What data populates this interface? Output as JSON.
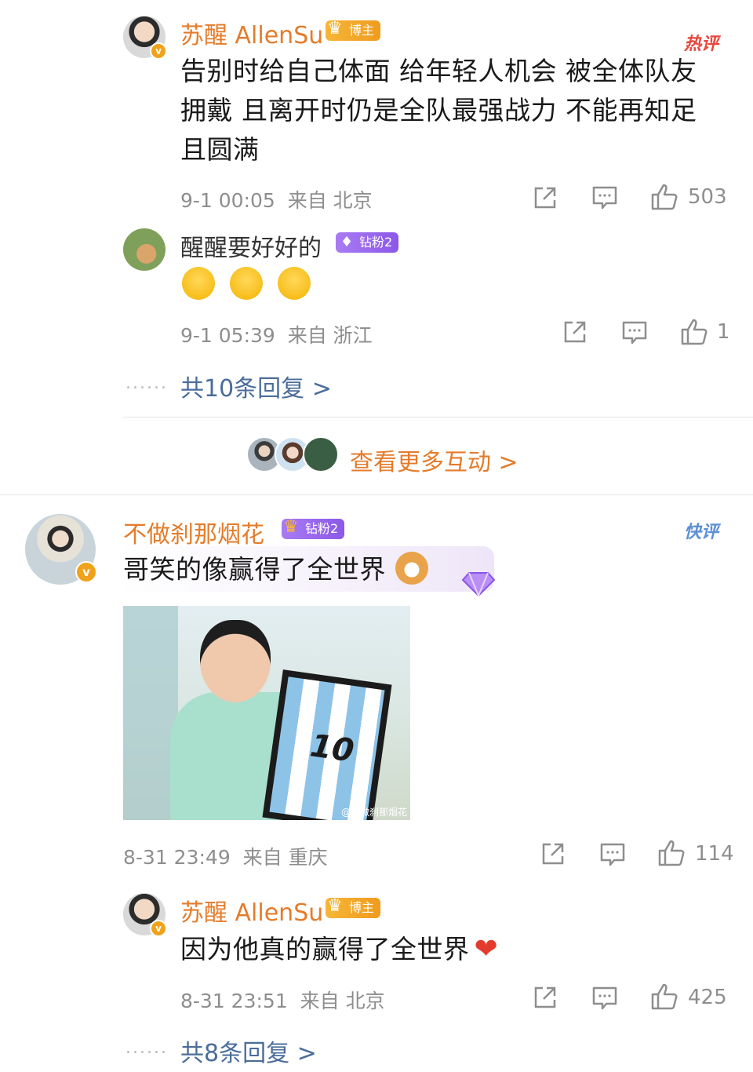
{
  "comments": [
    {
      "author": "苏醒 AllenSu",
      "badge": "博主",
      "tag": "热评",
      "content": "告别时给自己体面 给年轻人机会 被全体队友拥戴 且离开时仍是全队最强战力 不能再知足且圆满",
      "time": "9-1 00:05",
      "location": "来自 北京",
      "likes": "503"
    },
    {
      "author": "醒醒要好好的",
      "badge": "钻粉2",
      "content_emojis": [
        "crying-emoji",
        "crying-emoji",
        "crying-emoji"
      ],
      "time": "9-1 05:39",
      "location": "来自 浙江",
      "likes": "1"
    },
    {
      "author": "不做刹那烟花",
      "badge": "钻粉2",
      "tag": "快评",
      "content": "哥笑的像赢得了全世界",
      "image_watermark": "@不做刹那烟花",
      "jersey_number": "10",
      "time": "8-31 23:49",
      "location": "来自 重庆",
      "likes": "114"
    },
    {
      "author": "苏醒 AllenSu",
      "badge": "博主",
      "content": "因为他真的赢得了全世界",
      "time": "8-31 23:51",
      "location": "来自 北京",
      "likes": "425"
    }
  ],
  "reply_links": {
    "first": "共10条回复 >",
    "second": "共8条回复 >"
  },
  "dots": "......",
  "more_interactions": "查看更多互动 >",
  "colors": {
    "username": "#e47c2b",
    "reply_link": "#4a6d9a",
    "hot_tag": "#e8453c",
    "quick_tag": "#5b8fd6",
    "gold_badge": "#f3a929",
    "purple_badge": "#9a68ee"
  }
}
